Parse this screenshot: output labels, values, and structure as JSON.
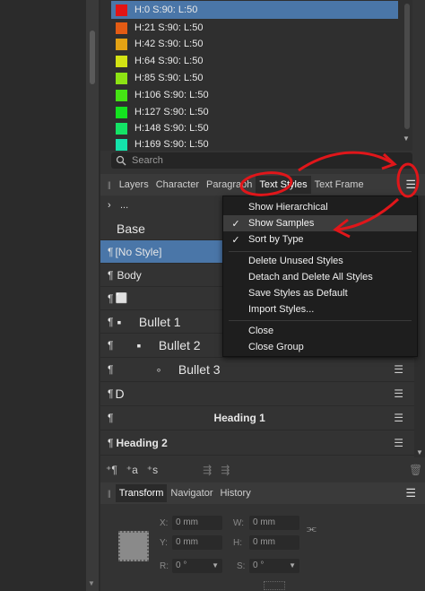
{
  "swatches": [
    {
      "label": "H:0 S:90: L:50",
      "color": "#e31414"
    },
    {
      "label": "H:21 S:90: L:50",
      "color": "#e35b14"
    },
    {
      "label": "H:42 S:90: L:50",
      "color": "#e3a214"
    },
    {
      "label": "H:64 S:90: L:50",
      "color": "#d3e314"
    },
    {
      "label": "H:85 S:90: L:50",
      "color": "#8de314"
    },
    {
      "label": "H:106 S:90: L:50",
      "color": "#45e314"
    },
    {
      "label": "H:127 S:90: L:50",
      "color": "#14e31f"
    },
    {
      "label": "H:148 S:90: L:50",
      "color": "#14e366"
    },
    {
      "label": "H:169 S:90: L:50",
      "color": "#14e3ac"
    }
  ],
  "search": {
    "placeholder": "Search"
  },
  "tabs": [
    "Layers",
    "Character",
    "Paragraph",
    "Text Styles",
    "Text Frame"
  ],
  "path": "...",
  "styles": [
    {
      "label": "Base",
      "para": ""
    },
    {
      "label": "[No Style]",
      "para": "¶"
    },
    {
      "label": "Body",
      "para": "¶"
    },
    {
      "label": "⬜",
      "para": "¶"
    },
    {
      "label": "▪     Bullet 1",
      "para": "¶"
    },
    {
      "label": "▪     Bullet 2",
      "para": "¶"
    },
    {
      "label": "◦     Bullet 3",
      "para": "¶"
    },
    {
      "label": "D",
      "para": "¶"
    },
    {
      "label": "Heading 1",
      "para": "¶"
    },
    {
      "label": "Heading 2",
      "para": "¶"
    }
  ],
  "menu": {
    "items": [
      {
        "label": "Show Hierarchical",
        "checked": ""
      },
      {
        "label": "Show Samples",
        "checked": "✓"
      },
      {
        "label": "Sort by Type",
        "checked": "✓"
      },
      {
        "label": "Delete Unused Styles",
        "checked": ""
      },
      {
        "label": "Detach and Delete All Styles",
        "checked": ""
      },
      {
        "label": "Save Styles as Default",
        "checked": ""
      },
      {
        "label": "Import Styles...",
        "checked": ""
      },
      {
        "label": "Close",
        "checked": ""
      },
      {
        "label": "Close Group",
        "checked": ""
      }
    ]
  },
  "footer_tools": [
    "⁺¶",
    "⁺a",
    "⁺s"
  ],
  "tabs2": [
    "Transform",
    "Navigator",
    "History"
  ],
  "transform": {
    "x_label": "X:",
    "x_value": "0 mm",
    "y_label": "Y:",
    "y_value": "0 mm",
    "w_label": "W:",
    "w_value": "0 mm",
    "h_label": "H:",
    "h_value": "0 mm",
    "r_label": "R:",
    "r_value": "0 °",
    "s_label": "S:",
    "s_value": "0 °"
  },
  "colors": {
    "selection": "#4a76a8",
    "annotation": "#e0161a"
  },
  "icons": [
    "search-icon",
    "panel-menu-icon",
    "grip-icon",
    "row-menu-icon",
    "link-icon",
    "trash-icon"
  ]
}
